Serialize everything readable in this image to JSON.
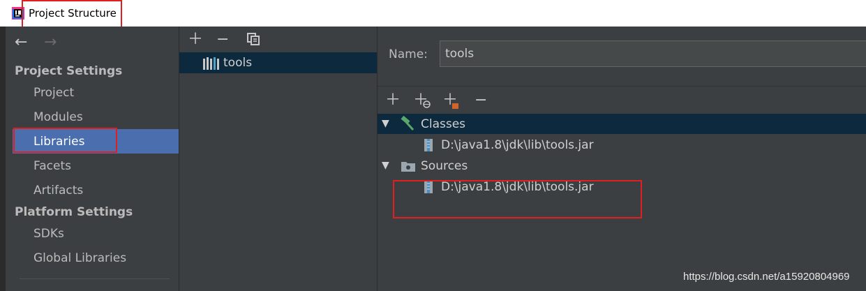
{
  "window": {
    "title": "Project Structure"
  },
  "nav": {
    "back_icon": "arrow-left-icon",
    "forward_icon": "arrow-right-icon",
    "sections": [
      {
        "heading": "Project Settings",
        "items": [
          "Project",
          "Modules",
          "Libraries",
          "Facets",
          "Artifacts"
        ]
      },
      {
        "heading": "Platform Settings",
        "items": [
          "SDKs",
          "Global Libraries"
        ]
      }
    ],
    "selected": "Libraries"
  },
  "libraries_panel": {
    "toolbar": [
      "plus-icon",
      "minus-icon",
      "copy-icon"
    ],
    "items": [
      {
        "name": "tools",
        "icon": "library-icon"
      }
    ]
  },
  "details": {
    "name_label": "Name:",
    "name_value": "tools",
    "toolbar": [
      "plus-icon",
      "add-url-icon",
      "add-jar-icon",
      "minus-icon"
    ],
    "tree": {
      "classes": {
        "label": "Classes",
        "icon": "hammer-icon",
        "entries": [
          "D:\\java1.8\\jdk\\lib\\tools.jar"
        ]
      },
      "sources": {
        "label": "Sources",
        "icon": "folder-icon",
        "entries": [
          "D:\\java1.8\\jdk\\lib\\tools.jar"
        ]
      }
    }
  },
  "watermark": "https://blog.csdn.net/a15920804969",
  "colors": {
    "selection": "#4b6eaf",
    "tree_selection": "#0d293e",
    "highlight_box": "#e02020",
    "background": "#3c3f41"
  }
}
